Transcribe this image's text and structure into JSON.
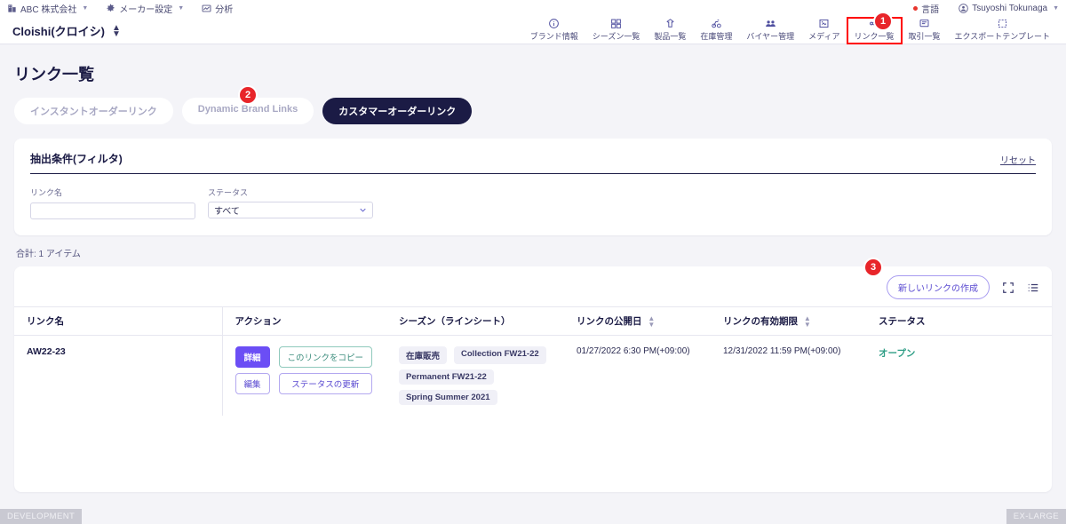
{
  "utilbar": {
    "company": "ABC 株式会社",
    "maker_settings": "メーカー設定",
    "analytics": "分析",
    "language": "言語",
    "user": "Tsuyoshi Tokunaga"
  },
  "navbar": {
    "brand": "Cloishi(クロイシ)",
    "items": [
      {
        "label": "ブランド情報",
        "icon": "info-icon"
      },
      {
        "label": "シーズン一覧",
        "icon": "grid-icon"
      },
      {
        "label": "製品一覧",
        "icon": "product-icon"
      },
      {
        "label": "在庫管理",
        "icon": "inventory-icon"
      },
      {
        "label": "バイヤー管理",
        "icon": "buyers-icon"
      },
      {
        "label": "メディア",
        "icon": "media-icon"
      },
      {
        "label": "リンク一覧",
        "icon": "share-icon"
      },
      {
        "label": "取引一覧",
        "icon": "orders-icon"
      },
      {
        "label": "エクスポートテンプレート",
        "icon": "export-icon"
      }
    ]
  },
  "markers": {
    "one": "1",
    "two": "2",
    "three": "3"
  },
  "page": {
    "title": "リンク一覧",
    "tabs": [
      {
        "label": "インスタントオーダーリンク",
        "active": false
      },
      {
        "label": "Dynamic Brand Links",
        "active": false
      },
      {
        "label": "カスタマーオーダーリンク",
        "active": true
      }
    ]
  },
  "filter": {
    "title": "抽出条件(フィルタ)",
    "reset": "リセット",
    "link_name_label": "リンク名",
    "link_name_value": "",
    "link_name_placeholder": "",
    "status_label": "ステータス",
    "status_value": "すべて",
    "status_options": [
      "すべて"
    ]
  },
  "table": {
    "total": "合計: 1 アイテム",
    "create_button": "新しいリンクの作成",
    "columns": [
      "リンク名",
      "アクション",
      "シーズン（ラインシート）",
      "リンクの公開日",
      "リンクの有効期限",
      "ステータス"
    ],
    "row": {
      "link_name": "AW22-23",
      "actions": {
        "detail": "詳細",
        "copy_link": "このリンクをコピー",
        "edit": "編集",
        "update_status": "ステータスの更新"
      },
      "season_tags_row1": [
        "在庫販売",
        "Collection FW21-22"
      ],
      "season_tags_row2": [
        "Permanent FW21-22"
      ],
      "season_tags_row3": [
        "Spring Summer 2021"
      ],
      "published_at": "01/27/2022 6:30 PM(+09:00)",
      "expires_at": "12/31/2022 11:59 PM(+09:00)",
      "status": "オープン"
    }
  },
  "footer": {
    "env_left": "DEVELOPMENT",
    "env_right": "EX-LARGE"
  },
  "colors": {
    "accent_purple": "#6b4ef5",
    "active_tab": "#1b1b45",
    "status_open": "#2f9e86",
    "marker_red": "#e8252a"
  }
}
